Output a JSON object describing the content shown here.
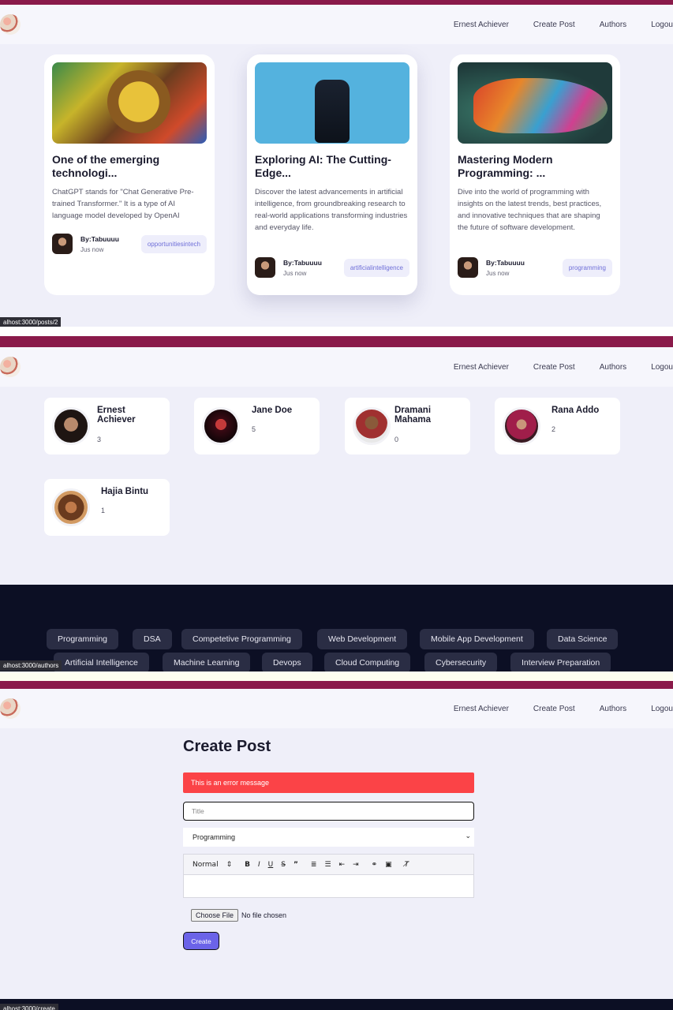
{
  "nav": {
    "user": "Ernest Achiever",
    "create_post": "Create Post",
    "authors": "Authors",
    "logout": "Logou"
  },
  "posts": [
    {
      "title": "One of the emerging technologi...",
      "excerpt": "ChatGPT stands for \"Chat Generative Pre-trained Transformer.\" It is a type of AI language model developed by OpenAI",
      "author": "By:Tabuuuu",
      "time": "Jus now",
      "category": "opportunitiesintech"
    },
    {
      "title": "Exploring AI: The Cutting-Edge...",
      "excerpt": "Discover the latest advancements in artificial intelligence, from groundbreaking research to real-world applications transforming industries and everyday life.",
      "author": "By:Tabuuuu",
      "time": "Jus now",
      "category": "artificialintelligence"
    },
    {
      "title": "Mastering Modern Programming: ...",
      "excerpt": "Dive into the world of programming with insights on the latest trends, best practices, and innovative techniques that are shaping the future of software development.",
      "author": "By:Tabuuuu",
      "time": "Jus now",
      "category": "programming"
    }
  ],
  "status_urls": {
    "posts": "alhost:3000/posts/2",
    "authors": "alhost:3000/authors",
    "create": "alhost:3000/create"
  },
  "authors": [
    {
      "name": "Ernest Achiever",
      "count": "3"
    },
    {
      "name": "Jane Doe",
      "count": "5"
    },
    {
      "name": "Dramani Mahama",
      "count": "0"
    },
    {
      "name": "Rana Addo",
      "count": "2"
    },
    {
      "name": "Hajia Bintu",
      "count": "1"
    }
  ],
  "footer_categories": [
    "Programming",
    "DSA",
    "Competetive Programming",
    "Web Development",
    "Mobile App Development",
    "Data Science",
    "Artificial Intelligence",
    "Machine Learning",
    "Devops",
    "Cloud Computing",
    "Cybersecurity",
    "Interview Preparation"
  ],
  "create": {
    "heading": "Create Post",
    "error": "This is an error message",
    "title_placeholder": "Title",
    "category_selected": "Programming",
    "toolbar_heading": "Normal",
    "file_button": "Choose File",
    "file_status": "No file chosen",
    "submit": "Create"
  },
  "colors": {
    "accent": "#6b63e8",
    "error": "#fb4347",
    "footer": "#0c0f24",
    "browser_bar": "#8a1a4a",
    "background": "#efeff9"
  }
}
